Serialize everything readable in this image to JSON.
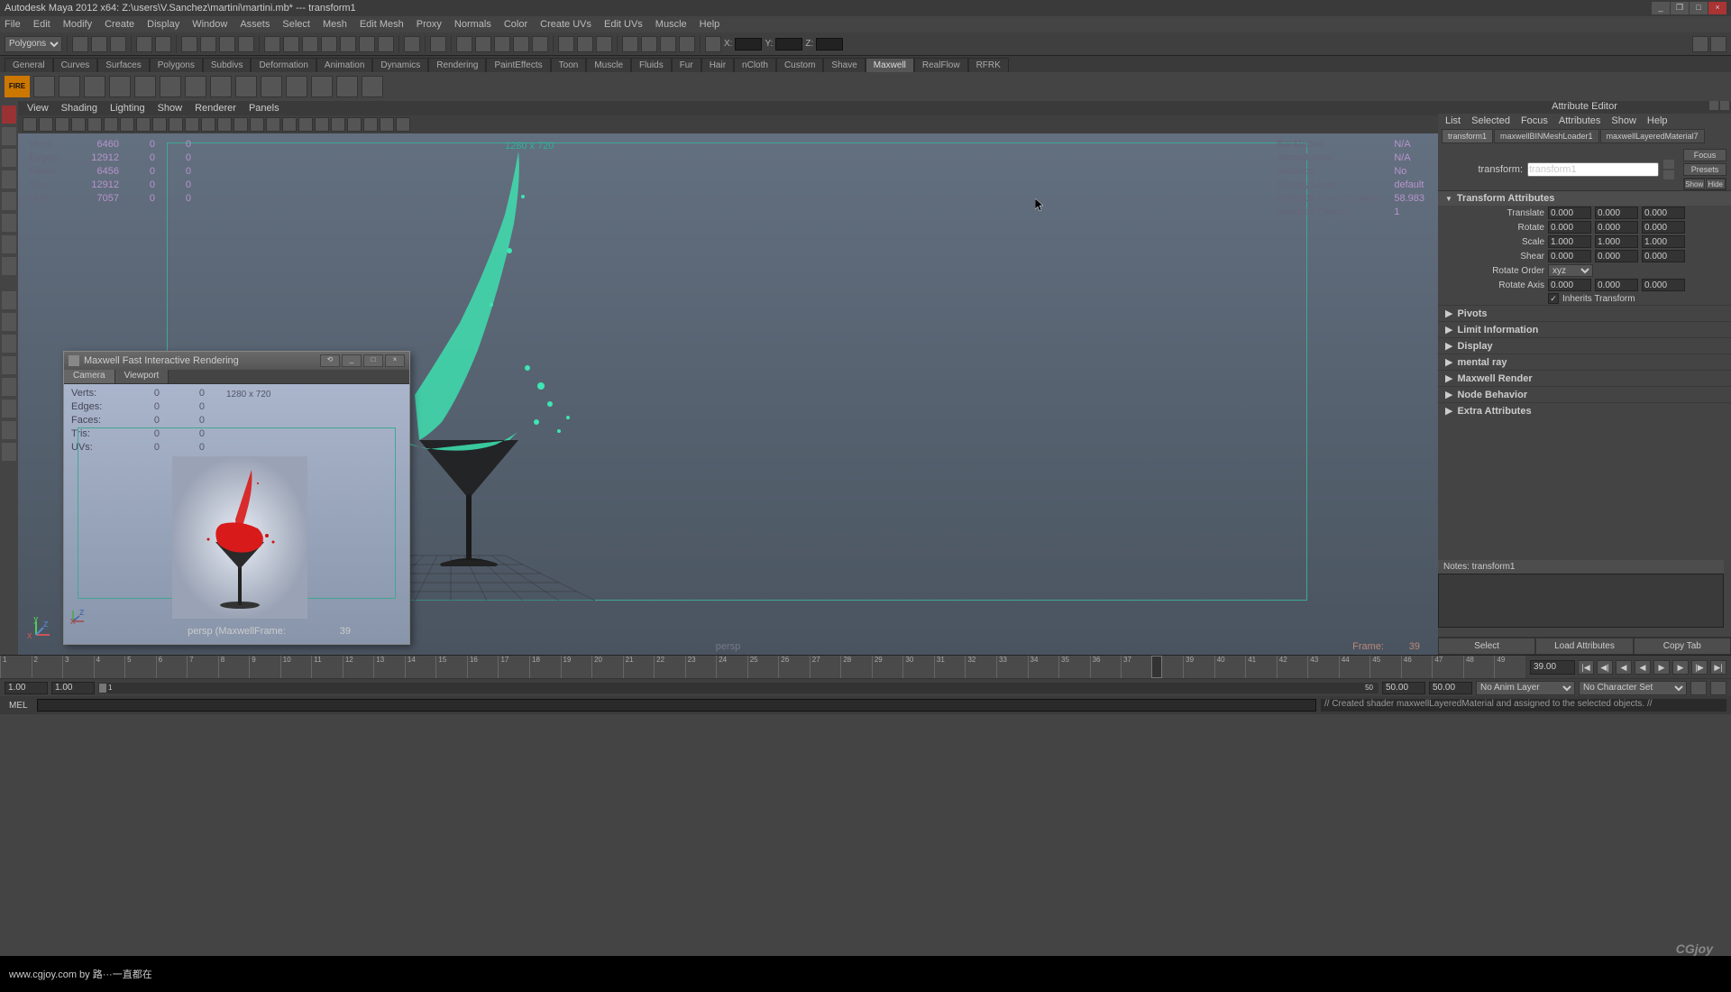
{
  "title": "Autodesk Maya 2012 x64: Z:\\users\\V.Sanchez\\martini\\martini.mb*   ---   transform1",
  "menus": [
    "File",
    "Edit",
    "Modify",
    "Create",
    "Display",
    "Window",
    "Assets",
    "Select",
    "Mesh",
    "Edit Mesh",
    "Proxy",
    "Normals",
    "Color",
    "Create UVs",
    "Edit UVs",
    "Muscle",
    "Help"
  ],
  "mode": "Polygons",
  "coord_labels": {
    "x": "X:",
    "y": "Y:",
    "z": "Z:"
  },
  "shelf_tabs": [
    "General",
    "Curves",
    "Surfaces",
    "Polygons",
    "Subdivs",
    "Deformation",
    "Animation",
    "Dynamics",
    "Rendering",
    "PaintEffects",
    "Toon",
    "Muscle",
    "Fluids",
    "Fur",
    "Hair",
    "nCloth",
    "Custom",
    "Shave",
    "Maxwell",
    "RealFlow",
    "RFRK"
  ],
  "shelf_active": "Maxwell",
  "shelf_fire": "FIRE",
  "vp_menu": [
    "View",
    "Shading",
    "Lighting",
    "Show",
    "Renderer",
    "Panels"
  ],
  "vp_stats_left": [
    {
      "lbl": "Verts:",
      "v": "6460",
      "a": "0",
      "b": "0"
    },
    {
      "lbl": "Edges:",
      "v": "12912",
      "a": "0",
      "b": "0"
    },
    {
      "lbl": "Faces:",
      "v": "6456",
      "a": "0",
      "b": "0"
    },
    {
      "lbl": "Tris:",
      "v": "12912",
      "a": "0",
      "b": "0"
    },
    {
      "lbl": "UVs:",
      "v": "7057",
      "a": "0",
      "b": "0"
    }
  ],
  "vp_res": "1280 x 720",
  "vp_stats_right": [
    {
      "lbl": "Backfaces:",
      "v": "N/A"
    },
    {
      "lbl": "Smoothness:",
      "v": "N/A"
    },
    {
      "lbl": "Instance:",
      "v": "No"
    },
    {
      "lbl": "Display Layer:",
      "v": "default"
    },
    {
      "lbl": "Distance From Camera:",
      "v": "58.983"
    },
    {
      "lbl": "Selected Objects:",
      "v": "1"
    }
  ],
  "persp": "persp",
  "frame_label": "Frame:",
  "frame_value": "39",
  "fire": {
    "title": "Maxwell Fast Interactive Rendering",
    "tabs": [
      "Camera",
      "Viewport"
    ],
    "stats": [
      {
        "lbl": "Verts:",
        "v": "0",
        "a": "0"
      },
      {
        "lbl": "Edges:",
        "v": "0",
        "a": "0"
      },
      {
        "lbl": "Faces:",
        "v": "0",
        "a": "0"
      },
      {
        "lbl": "Tris:",
        "v": "0",
        "a": "0"
      },
      {
        "lbl": "UVs:",
        "v": "0",
        "a": "0"
      }
    ],
    "res": "1280 x 720",
    "bottom": "persp (MaxwellFrame:",
    "bottom_val": "39"
  },
  "ae": {
    "title": "Attribute Editor",
    "menu": [
      "List",
      "Selected",
      "Focus",
      "Attributes",
      "Show",
      "Help"
    ],
    "tabs": [
      "transform1",
      "maxwellBINMeshLoader1",
      "maxwellLayeredMaterial7"
    ],
    "transform_label": "transform:",
    "transform_name": "transform1",
    "btns": [
      "Focus",
      "Presets",
      "Show",
      "Hide"
    ],
    "section": "Transform Attributes",
    "attrs": {
      "translate_lbl": "Translate",
      "translate": [
        "0.000",
        "0.000",
        "0.000"
      ],
      "rotate_lbl": "Rotate",
      "rotate": [
        "0.000",
        "0.000",
        "0.000"
      ],
      "scale_lbl": "Scale",
      "scale": [
        "1.000",
        "1.000",
        "1.000"
      ],
      "shear_lbl": "Shear",
      "shear": [
        "0.000",
        "0.000",
        "0.000"
      ],
      "rotorder_lbl": "Rotate Order",
      "rotorder": "xyz",
      "rotaxis_lbl": "Rotate Axis",
      "rotaxis": [
        "0.000",
        "0.000",
        "0.000"
      ],
      "inherit_lbl": "Inherits Transform"
    },
    "collapsed": [
      "Pivots",
      "Limit Information",
      "Display",
      "mental ray",
      "Maxwell Render",
      "Node Behavior",
      "Extra Attributes"
    ],
    "notes_label": "Notes: transform1",
    "bottom": [
      "Select",
      "Load Attributes",
      "Copy Tab"
    ]
  },
  "timeline": {
    "cur": "39.00",
    "start": "1.00",
    "start2": "1.00",
    "startfield": "1",
    "end": "50",
    "end2": "50.00",
    "end3": "50.00",
    "anim": "No Anim Layer",
    "char": "No Character Set"
  },
  "cmd": {
    "mel": "MEL",
    "output": "// Created shader maxwellLayeredMaterial and assigned to the selected objects. //"
  },
  "watermark": "CGjoy",
  "footer": "www.cgjoy.com by 路···一直都在"
}
